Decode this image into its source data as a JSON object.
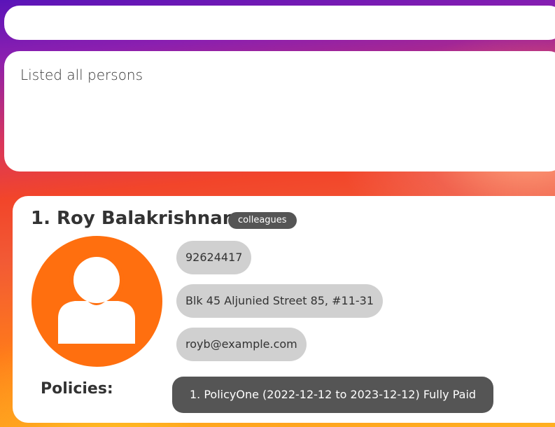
{
  "command_box": {
    "value": ""
  },
  "result_display": {
    "text": "Listed all persons"
  },
  "person_list": {
    "persons": [
      {
        "index_name": "1. Roy Balakrishnan",
        "tags": [
          "colleagues"
        ],
        "phone": "92624417",
        "address": "Blk 45 Aljunied Street 85, #11-31",
        "email": "royb@example.com",
        "policies_label": "Policies:",
        "policies": [
          "1. PolicyOne (2022-12-12 to 2023-12-12) Fully Paid"
        ],
        "avatar_icon": "user-silhouette-icon"
      }
    ]
  },
  "colors": {
    "avatar": "#ff6f0f",
    "tag_bg": "#555555",
    "field_bg": "#d0d0d0",
    "policy_bg": "#555555"
  }
}
